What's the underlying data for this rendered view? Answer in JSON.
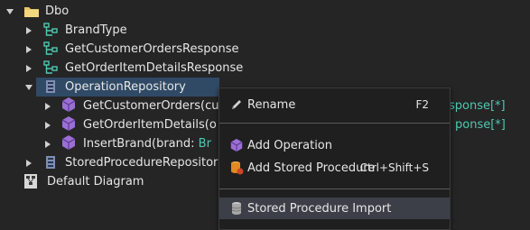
{
  "tree": {
    "root": {
      "label": "Dbo",
      "icon": "folder-icon"
    },
    "items": [
      {
        "label": "BrandType",
        "icon": "type-icon"
      },
      {
        "label": "GetCustomerOrdersResponse",
        "icon": "type-icon"
      },
      {
        "label": "GetOrderItemDetailsResponse",
        "icon": "type-icon"
      },
      {
        "label": "OperationRepository",
        "icon": "repository-icon",
        "selected": true,
        "children": [
          {
            "name": "GetCustomerOrders(cu",
            "suffix": "sponse[*]"
          },
          {
            "name": "GetOrderItemDetails(o",
            "suffix": "ponse[*]"
          },
          {
            "name": "InsertBrand(brand: ",
            "suffix": "Br"
          }
        ]
      },
      {
        "label": "StoredProcedureRepositor",
        "icon": "repository-icon"
      }
    ],
    "diagram": {
      "label": "Default Diagram",
      "icon": "diagram-icon"
    }
  },
  "context_menu": {
    "items": [
      {
        "label": "Rename",
        "shortcut": "F2",
        "icon": "rename-icon"
      },
      {
        "label": "Add Operation",
        "shortcut": "",
        "icon": "operation-icon"
      },
      {
        "label": "Add Stored Procedure",
        "shortcut": "Ctrl+Shift+S",
        "icon": "stored-procedure-icon"
      },
      {
        "label": "Stored Procedure Import",
        "shortcut": "",
        "icon": "database-import-icon"
      }
    ]
  },
  "colors": {
    "background": "#252526",
    "selected_row": "#304a66",
    "menu_background": "#1f1f1f",
    "menu_hover": "#3c3f47",
    "type_text": "#4ec9b0",
    "operation_icon": "#9b6fd6",
    "folder_icon": "#e8c766"
  }
}
